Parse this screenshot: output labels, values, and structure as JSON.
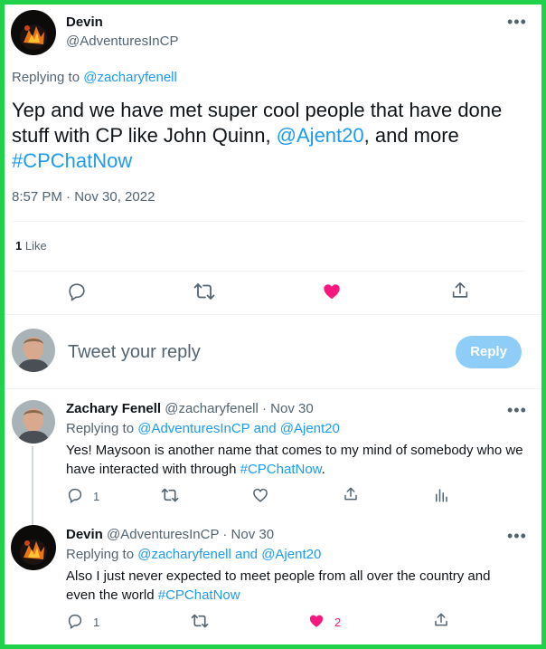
{
  "main_tweet": {
    "author_name": "Devin",
    "author_handle": "@AdventuresInCP",
    "replying_to_prefix": "Replying to",
    "replying_to_user": "@zacharyfenell",
    "text_1": "Yep and we have met super cool people that have done",
    "text_2a": "stuff with CP like John Quinn, ",
    "text_2_mention": "@Ajent20",
    "text_2b": ", and more",
    "hashtag": "#CPChatNow",
    "timestamp": "8:57 PM · Nov 30, 2022",
    "likes_count": "1",
    "likes_label": "Like"
  },
  "reply_box": {
    "placeholder": "Tweet your reply",
    "button_label": "Reply"
  },
  "replies": [
    {
      "name": "Zachary Fenell",
      "meta": "@zacharyfenell · Nov 30",
      "replying_prefix": "Replying to",
      "replying_to": "@AdventuresInCP and @Ajent20",
      "text_1": "Yes! Maysoon is another name that comes to my mind of somebody who we",
      "text_2": "have interacted with through ",
      "hashtag": "#CPChatNow",
      "text_2_end": ".",
      "reply_count": "1"
    },
    {
      "name": "Devin",
      "meta": "@AdventuresInCP · Nov 30",
      "replying_prefix": "Replying to",
      "replying_to": "@zacharyfenell and @Ajent20",
      "text_1": "Also I just never expected to meet people from all over the country and",
      "text_2": "even the world ",
      "hashtag": "#CPChatNow",
      "reply_count": "1",
      "like_count": "2"
    }
  ],
  "colors": {
    "accent": "#1d9bf0",
    "like_active": "#f91880",
    "border": "#1fd24a"
  }
}
